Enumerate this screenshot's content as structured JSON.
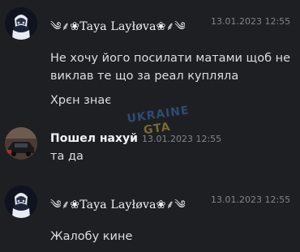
{
  "messages": [
    {
      "author": "༄⸙❀Taya Layłøva❀⸙༄",
      "timestamp": "13.01.2023 12:55",
      "lines": [
        "Не хочу його посилати матами щоб не виклав те що за реал купляла",
        "Хрєн знає"
      ]
    },
    {
      "author": "Пошел нахуй",
      "timestamp": "13.01.2023 12:55",
      "lines": [
        "та да"
      ]
    },
    {
      "author": "༄⸙❀Taya Layłøva❀⸙༄",
      "timestamp": "13.01.2023 12:55",
      "lines": [
        "Жалобу кине"
      ]
    }
  ],
  "watermark": {
    "line1": "UKRAINE",
    "line2": "GTA"
  },
  "colors": {
    "background": "#1e1f22",
    "author": "#f2f3f5",
    "timestamp": "#80848e",
    "text": "#dbdee1"
  },
  "icons": {
    "avatar_taya": "anime-girl-avatar-icon",
    "avatar_user2": "dark-car-avatar-icon"
  }
}
